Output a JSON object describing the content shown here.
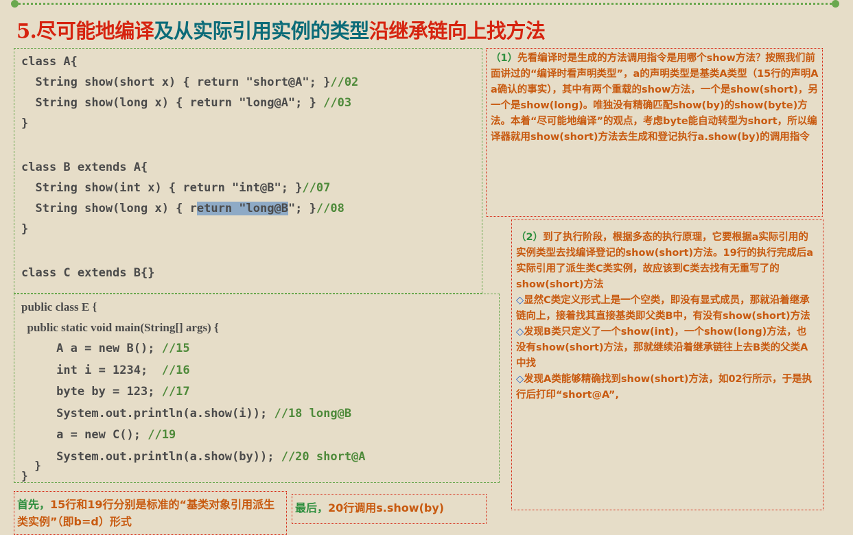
{
  "title": {
    "number": "5.",
    "part1": "尽可能地编译",
    "part2": "及从实际引用实例的类型",
    "part3": "沿继承链向上找方法"
  },
  "code1": {
    "l1": "class A{",
    "l2_code": "  String show(short x) { return \"short@A\"; }",
    "l2_cm": "//02",
    "l3_code": "  String show(long x) { return \"long@A\"; }",
    "l3_cm": " //03",
    "l4": "}",
    "l5": "class B extends A{",
    "l6_code": "  String show(int x) { return \"int@B\"; }",
    "l6_cm": "//07",
    "l7_a": "  String show(long x) { r",
    "l7_hl": "eturn \"long@B",
    "l7_b": "\"; }",
    "l7_cm": "//08",
    "l8": "}",
    "l9": "class C extends B{}"
  },
  "code2": {
    "l1": "public class E {",
    "l2": "  public static void main(String[] args) {",
    "l3_code": "     A a = new B(); ",
    "l3_cm": "//15",
    "l4_code": "     int i = 1234;  ",
    "l4_cm": "//16",
    "l5_code": "     byte by = 123; ",
    "l5_cm": "//17",
    "l6_code": "     System.out.println(a.show(i)); ",
    "l6_cm": "//18 long@B",
    "l7_code": "     a = new C(); ",
    "l7_cm": "//19",
    "l8_code": "     System.out.println(a.show(by)); ",
    "l8_cm": "//20 short@A",
    "l9": "  }",
    "l10": "}"
  },
  "note1": {
    "num": "（1）",
    "text": "先看编译时是生成的方法调用指令是用哪个show方法？按照我们前面讲过的“编译时看声明类型”，a的声明类型是基类A类型（15行的声明A a确认的事实），其中有两个重载的show方法，一个是show(short)，另一个是show(long)。唯独没有精确匹配show(by)的show(byte)方法。本着“尽可能地编译”的观点，考虑byte能自动转型为short，所以编译器就用show(short)方法去生成和登记执行a.show(by)的调用指令"
  },
  "note2": {
    "num": "（2）",
    "p1": "到了执行阶段，根据多态的执行原理，它要根据a实际引用的实例类型去找编译登记的show(short)方法。19行的执行完成后a实际引用了派生类C类实例，故应该到C类去找有无重写了的show(short)方法",
    "diamond": "◇",
    "p2": "显然C类定义形式上是一个空类，即没有显式成员，那就沿着继承链向上，接着找其直接基类即父类B中，有没有show(short)方法",
    "p3": "发现B类只定义了一个show(int)，一个show(long)方法，也没有show(short)方法，那就继续沿着继承链往上去B类的父类A中找",
    "p4": "发现A类能够精确找到show(short)方法，如02行所示，于是执行后打印“short@A”,"
  },
  "note3": {
    "lead": "首先，",
    "text": "15行和19行分别是标准的“基类对象引用派生类实例”（即b=d）形式"
  },
  "note4": {
    "lead": "最后，",
    "text": "20行调用s.show(by)"
  },
  "colors": {
    "background": "#e6ddc8",
    "red": "#d6230f",
    "teal": "#0b6b78",
    "green": "#6aa84f",
    "orange": "#c85a10"
  }
}
